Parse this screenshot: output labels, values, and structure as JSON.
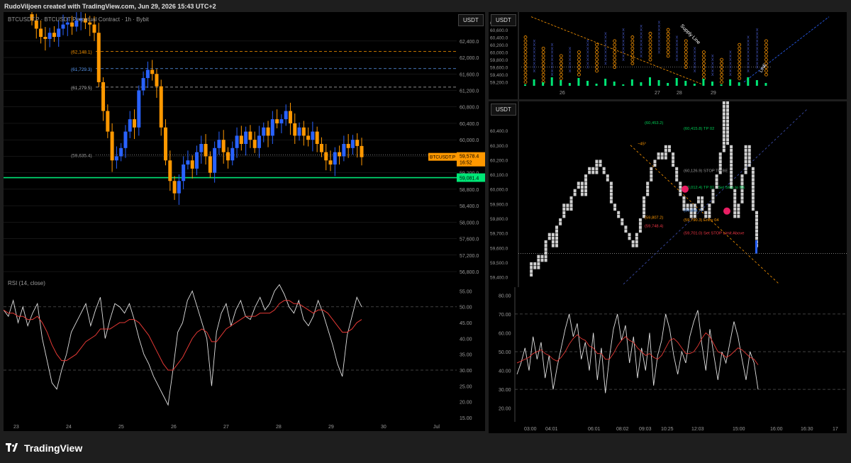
{
  "header": "RudoViljoen created with TradingView.com, Jun 29, 2026 15:43 UTC+2",
  "footer": {
    "brand": "TradingView"
  },
  "colors": {
    "bull": "#2962ff",
    "bear": "#ff9800",
    "support": "#00e676",
    "grid": "#2a2a2a"
  },
  "chart_data": [
    {
      "type": "candlestick",
      "title": "BTCUSDT.P · BTCUSDT Perpetual Contract · 1h · Bybit",
      "unit": "USDT",
      "xticks": [
        "23",
        "24",
        "25",
        "26",
        "27",
        "28",
        "29",
        "30",
        "Jul"
      ],
      "ylim": [
        56800,
        63000
      ],
      "yticks": [
        "62,400.0",
        "62,000.0",
        "61,600.0",
        "61,200.0",
        "60,800.0",
        "60,400.0",
        "60,000.0",
        "59,600.0",
        "59,200.0",
        "58,800.0",
        "58,400.0",
        "58,000.0",
        "57,600.0",
        "57,200.0",
        "56,800.0"
      ],
      "closes": [
        62900,
        62700,
        62500,
        62450,
        62600,
        62500,
        62700,
        62800,
        62850,
        62750,
        62900,
        62950,
        62850,
        62800,
        62600,
        61400,
        60700,
        60200,
        59500,
        59600,
        59800,
        60200,
        60500,
        60300,
        61200,
        61500,
        61700,
        61600,
        61300,
        60300,
        59500,
        59000,
        58700,
        59000,
        59400,
        59500,
        59300,
        59700,
        59900,
        59600,
        59200,
        59800,
        60000,
        59700,
        59500,
        59800,
        60100,
        59900,
        60200,
        60000,
        59800,
        60100,
        60300,
        60100,
        60500,
        60400,
        60500,
        60700,
        60400,
        60100,
        60300,
        60100,
        60000,
        60200,
        59900,
        59700,
        59500,
        59400,
        59700,
        59600,
        59900,
        59800,
        60000,
        59850,
        59578
      ],
      "levels": [
        {
          "label": "(62,148.1)",
          "value": 62148.1,
          "color": "#ff9800",
          "style": "dash"
        },
        {
          "label": "(61,729.3)",
          "value": 61729.3,
          "color": "#5b9cf6",
          "style": "dash"
        },
        {
          "label": "(61,279.5)",
          "value": 61279.5,
          "color": "#bbbbbb",
          "style": "dash"
        },
        {
          "label": "(59,635.4)",
          "value": 59635.4,
          "color": "#999999",
          "style": "dot"
        }
      ],
      "price_tag": {
        "symbol": "BTCUSDT.P",
        "price": "59,578.4",
        "timer": "16:52",
        "value": 59578.4
      },
      "support": {
        "label": "59,081.4",
        "value": 59081.4
      }
    },
    {
      "type": "line",
      "title": "RSI (14, close)",
      "ylim": [
        15,
        58
      ],
      "yticks": [
        "55.00",
        "50.00",
        "45.00",
        "40.00",
        "35.00",
        "30.00",
        "25.00",
        "20.00",
        "15.00"
      ],
      "hlines": [
        50,
        30
      ],
      "series": [
        {
          "values": [
            49,
            47,
            52,
            45,
            50,
            44,
            48,
            51,
            40,
            33,
            26,
            24,
            30,
            35,
            42,
            45,
            48,
            51,
            44,
            49,
            53,
            40,
            46,
            51,
            50,
            48,
            51,
            46,
            40,
            35,
            32,
            28,
            25,
            22,
            19,
            30,
            42,
            45,
            52,
            55,
            50,
            45,
            40,
            25,
            42,
            48,
            51,
            44,
            49,
            52,
            47,
            46,
            50,
            53,
            49,
            51,
            55,
            57,
            54,
            50,
            48,
            52,
            46,
            44,
            47,
            52,
            48,
            43,
            38,
            32,
            28,
            41,
            47,
            53,
            50
          ]
        },
        {
          "values": [
            49,
            48,
            48,
            47,
            47,
            46,
            46,
            47,
            45,
            42,
            38,
            35,
            33,
            33,
            34,
            35,
            37,
            39,
            40,
            41,
            43,
            43,
            43,
            44,
            45,
            45,
            46,
            46,
            45,
            43,
            41,
            38,
            35,
            32,
            30,
            30,
            32,
            34,
            37,
            40,
            42,
            43,
            42,
            39,
            39,
            41,
            43,
            44,
            45,
            46,
            47,
            47,
            47,
            48,
            48,
            48,
            49,
            51,
            52,
            52,
            51,
            51,
            50,
            49,
            48,
            49,
            49,
            48,
            46,
            44,
            42,
            42,
            43,
            45,
            46
          ]
        }
      ]
    },
    {
      "type": "point_and_figure",
      "unit": "USDT",
      "xticks": [
        "26",
        "27",
        "28",
        "29"
      ],
      "ylim": [
        59100,
        61000
      ],
      "yticks": [
        "60,800.0",
        "60,600.0",
        "60,400.0",
        "60,200.0",
        "60,000.0",
        "59,800.0",
        "59,600.0",
        "59,400.0",
        "59,200.0"
      ],
      "columns": [
        [
          59200,
          60400,
          "O"
        ],
        [
          59500,
          60300,
          "X"
        ],
        [
          59200,
          60100,
          "O"
        ],
        [
          59400,
          60200,
          "X"
        ],
        [
          59300,
          59900,
          "O"
        ],
        [
          59500,
          60100,
          "X"
        ],
        [
          59400,
          60000,
          "O"
        ],
        [
          59600,
          60300,
          "X"
        ],
        [
          59500,
          60200,
          "O"
        ],
        [
          59700,
          60500,
          "X"
        ],
        [
          59600,
          60300,
          "O"
        ],
        [
          59800,
          60600,
          "X"
        ],
        [
          59700,
          60400,
          "O"
        ],
        [
          59900,
          60700,
          "X"
        ],
        [
          59800,
          60500,
          "O"
        ],
        [
          60000,
          60800,
          "X"
        ],
        [
          59900,
          60600,
          "O"
        ],
        [
          59800,
          60400,
          "X"
        ],
        [
          59600,
          60300,
          "O"
        ],
        [
          59500,
          60100,
          "X"
        ],
        [
          59300,
          60000,
          "O"
        ],
        [
          59400,
          59900,
          "X"
        ],
        [
          59200,
          59800,
          "O"
        ],
        [
          59400,
          60000,
          "X"
        ],
        [
          59300,
          60200,
          "O"
        ],
        [
          59500,
          60400,
          "X"
        ],
        [
          59600,
          60600,
          "X"
        ],
        [
          59400,
          60300,
          "O"
        ]
      ],
      "annotations": [
        {
          "text": "Supply Line"
        },
        {
          "text": "LINE"
        }
      ]
    },
    {
      "type": "renko",
      "unit": "USDT",
      "ylim": [
        59330,
        60580
      ],
      "yticks": [
        "60,400.0",
        "60,300.0",
        "60,200.0",
        "60,100.0",
        "60,000.0",
        "59,900.0",
        "59,800.0",
        "59,700.0",
        "59,600.0",
        "59,500.0",
        "59,400.0"
      ],
      "path": [
        59400,
        59500,
        59450,
        59550,
        59500,
        59650,
        59700,
        59600,
        59750,
        59800,
        59900,
        59850,
        59950,
        60000,
        60050,
        59950,
        60100,
        60150,
        60100,
        60200,
        60150,
        60100,
        60050,
        59900,
        59850,
        59800,
        59750,
        59700,
        59650,
        59600,
        59700,
        59800,
        59950,
        60050,
        60150,
        60200,
        60250,
        60200,
        60300,
        60250,
        60150,
        60050,
        59950,
        59850,
        59900,
        59800,
        59900,
        59950,
        59850,
        59800,
        59900,
        60000,
        60100,
        60250,
        60600,
        60300,
        60000,
        59800,
        59900,
        60100,
        60300,
        60150,
        59850,
        59600
      ],
      "labels": [
        {
          "text": "(60,453.2)",
          "color": "#00c853",
          "value": 60453.2
        },
        {
          "text": "(60,415.8)   TP 02",
          "color": "#00c853",
          "value": 60415.8
        },
        {
          "text": "~45°",
          "color": "#ff9800",
          "value": 60310
        },
        {
          "text": "(60,126.9)   STOP TO BE",
          "color": "#9e9e9e",
          "value": 60126.9
        },
        {
          "text": "(60,012.4)   TP 01 · Set Stop to BE",
          "color": "#00c853",
          "value": 60012.4
        },
        {
          "text": "(59,854.7)",
          "color": "#5b9cf6",
          "value": 59854.7
        },
        {
          "text": "(59,807.2)",
          "color": "#ff9800",
          "value": 59807.2
        },
        {
          "text": "(59,790.3)   Entry 04",
          "color": "#ff9800",
          "value": 59790.3
        },
        {
          "text": "(59,748.4)",
          "color": "#f23645",
          "value": 59748.4
        },
        {
          "text": "(59,701.0)   Set STOP Limit Above",
          "color": "#f23645",
          "value": 59701
        }
      ]
    },
    {
      "type": "line",
      "xticks": [
        "03:00",
        "04:01",
        "06:01",
        "08:02",
        "09:03",
        "10:25",
        "12:03",
        "15:00",
        "16:00",
        "16:30",
        "17"
      ],
      "ylim": [
        15,
        82
      ],
      "yticks": [
        "80.00",
        "70.00",
        "60.00",
        "50.00",
        "40.00",
        "30.00",
        "20.00"
      ],
      "hlines": [
        70,
        50,
        30
      ],
      "series": [
        {
          "values": [
            38,
            44,
            52,
            40,
            58,
            46,
            55,
            36,
            48,
            30,
            42,
            52,
            62,
            70,
            58,
            65,
            46,
            55,
            40,
            60,
            35,
            52,
            28,
            47,
            62,
            70,
            56,
            64,
            44,
            58,
            36,
            52,
            40,
            60,
            32,
            48,
            56,
            70,
            62,
            48,
            38,
            50,
            44,
            58,
            66,
            72,
            54,
            40,
            62,
            48,
            35,
            50,
            44,
            55,
            66,
            58,
            46,
            35,
            50,
            44,
            30
          ]
        },
        {
          "values": [
            44,
            45,
            46,
            47,
            49,
            50,
            51,
            49,
            48,
            46,
            45,
            47,
            50,
            54,
            57,
            59,
            57,
            56,
            53,
            52,
            49,
            49,
            46,
            46,
            49,
            53,
            56,
            58,
            56,
            55,
            52,
            50,
            48,
            49,
            47,
            46,
            48,
            52,
            56,
            57,
            55,
            52,
            49,
            49,
            50,
            53,
            57,
            60,
            58,
            54,
            50,
            49,
            47,
            48,
            50,
            52,
            51,
            49,
            47,
            46,
            43
          ]
        }
      ]
    }
  ]
}
